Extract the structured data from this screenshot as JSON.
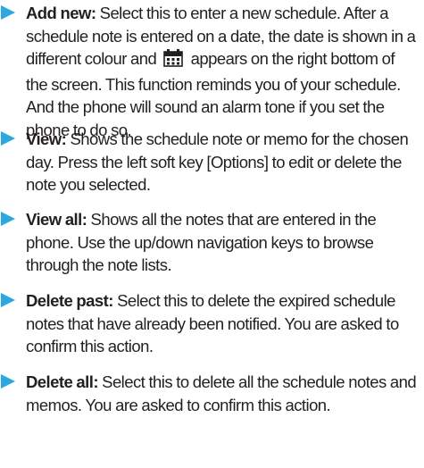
{
  "items": [
    {
      "term": "Add new:",
      "desc_before_icon": "Select this to enter a new schedule. After a schedule note is entered on a date, the date is shown in a  different colour and",
      "desc_after_icon": "appears on the right bottom of the screen. This function reminds you of your schedule. And the phone will sound an alarm tone if you set the phone to do so.",
      "icon": "calendar-note-icon"
    },
    {
      "term": "View:",
      "desc": "Shows the schedule note or memo for the chosen day. Press the left soft key [Options] to edit or delete the note you selected."
    },
    {
      "term": "View all:",
      "desc": "Shows all the notes that are entered in the phone. Use the up/down navigation keys to browse through the note lists."
    },
    {
      "term": "Delete past:",
      "desc": "Select this to delete the expired schedule notes that have already been notified. You are asked to confirm this action."
    },
    {
      "term": "Delete all:",
      "desc": "Select this to delete all the schedule notes and memos. You are asked to confirm this action."
    }
  ],
  "colors": {
    "bullet": "#2aa8df",
    "text": "#231f20"
  }
}
